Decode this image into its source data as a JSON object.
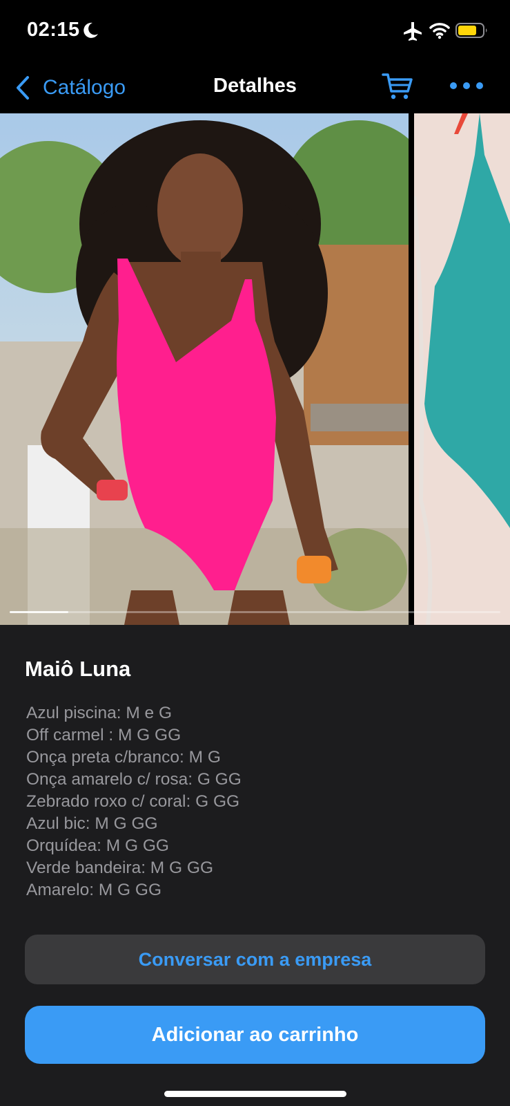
{
  "status_bar": {
    "time": "02:15",
    "icons": [
      "moon-icon",
      "airplane-icon",
      "wifi-icon",
      "battery-icon"
    ],
    "battery_color": "#ffd60a"
  },
  "nav": {
    "back_label": "Catálogo",
    "title": "Detalhes",
    "icons": [
      "chevron-left-icon",
      "cart-icon",
      "more-icon"
    ],
    "accent_color": "#3a9bf5"
  },
  "gallery": {
    "photos": [
      "model-pink-swimsuit-photo",
      "teal-swimsuit-photo"
    ],
    "progress_fraction": 0.12
  },
  "product": {
    "title": "Maiô Luna",
    "variants": [
      "Azul piscina: M e G",
      "Off carmel : M G GG",
      "Onça preta c/branco: M G",
      "Onça amarelo c/ rosa: G GG",
      "Zebrado roxo c/ coral: G GG",
      "Azul bic: M G GG",
      "Orquídea: M G GG",
      "Verde bandeira: M G GG",
      "Amarelo: M G GG"
    ]
  },
  "actions": {
    "chat_label": "Conversar com a empresa",
    "add_to_cart_label": "Adicionar ao carrinho"
  }
}
